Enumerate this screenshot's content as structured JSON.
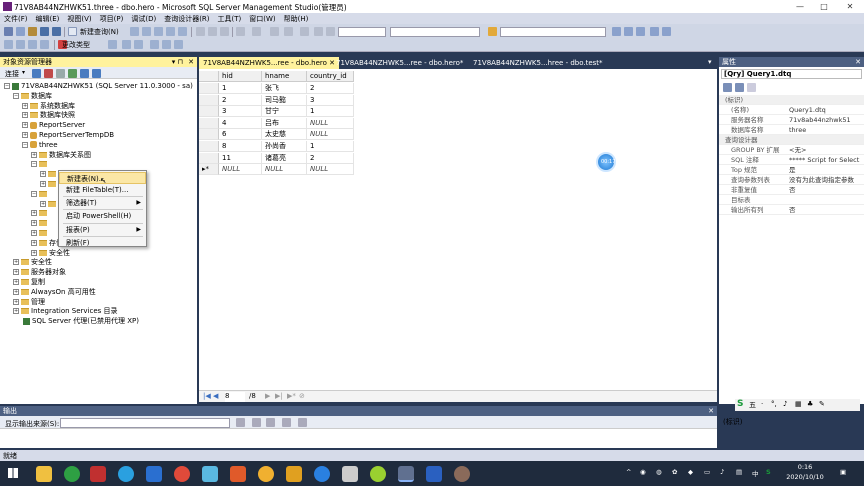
{
  "titlebar": {
    "title": "71V8AB44NZHWK51.three - dbo.hero - Microsoft SQL Server Management Studio(管理员)"
  },
  "menu": [
    "文件(F)",
    "编辑(E)",
    "视图(V)",
    "项目(P)",
    "调试(D)",
    "查询设计器(R)",
    "工具(T)",
    "窗口(W)",
    "帮助(H)"
  ],
  "toolbar": {
    "new_query": "新建查询(N)",
    "change_type": "更改类型"
  },
  "object_explorer": {
    "title": "对象资源管理器",
    "connect": "连接",
    "tree": [
      {
        "label": "71V8AB44NZHWK51 (SQL Server 11.0.3000 - sa)",
        "level": 0,
        "exp": "−",
        "icon": "server"
      },
      {
        "label": "数据库",
        "level": 1,
        "exp": "−",
        "icon": "folder"
      },
      {
        "label": "系统数据库",
        "level": 2,
        "exp": "+",
        "icon": "folder"
      },
      {
        "label": "数据库快照",
        "level": 2,
        "exp": "+",
        "icon": "folder"
      },
      {
        "label": "ReportServer",
        "level": 2,
        "exp": "+",
        "icon": "db"
      },
      {
        "label": "ReportServerTempDB",
        "level": 2,
        "exp": "+",
        "icon": "db"
      },
      {
        "label": "three",
        "level": 2,
        "exp": "−",
        "icon": "db"
      },
      {
        "label": "数据库关系图",
        "level": 3,
        "exp": "+",
        "icon": "folder"
      },
      {
        "label": "",
        "level": 3,
        "exp": "−",
        "icon": "folder"
      },
      {
        "label": "",
        "level": 4,
        "exp": "+",
        "icon": "folder"
      },
      {
        "label": "",
        "level": 4,
        "exp": "+",
        "icon": "folder"
      },
      {
        "label": "",
        "level": 3,
        "exp": "−",
        "icon": "folder"
      },
      {
        "label": "",
        "level": 4,
        "exp": "+",
        "icon": "folder"
      },
      {
        "label": "",
        "level": 3,
        "exp": "+",
        "icon": "folder"
      },
      {
        "label": "",
        "level": 3,
        "exp": "+",
        "icon": "folder"
      },
      {
        "label": "",
        "level": 3,
        "exp": "+",
        "icon": "folder"
      },
      {
        "label": "存储",
        "level": 3,
        "exp": "+",
        "icon": "folder"
      },
      {
        "label": "安全性",
        "level": 3,
        "exp": "+",
        "icon": "folder"
      },
      {
        "label": "安全性",
        "level": 1,
        "exp": "+",
        "icon": "folder"
      },
      {
        "label": "服务器对象",
        "level": 1,
        "exp": "+",
        "icon": "folder"
      },
      {
        "label": "复制",
        "level": 1,
        "exp": "+",
        "icon": "folder"
      },
      {
        "label": "AlwaysOn 高可用性",
        "level": 1,
        "exp": "+",
        "icon": "folder"
      },
      {
        "label": "管理",
        "level": 1,
        "exp": "+",
        "icon": "folder"
      },
      {
        "label": "Integration Services 目录",
        "level": 1,
        "exp": "+",
        "icon": "folder"
      },
      {
        "label": "SQL Server 代理(已禁用代理 XP)",
        "level": 1,
        "exp": "",
        "icon": "server"
      }
    ]
  },
  "context_menu": {
    "items": [
      {
        "label": "新建表(N)...",
        "submenu": false,
        "highlighted": true
      },
      {
        "label": "新建 FileTable(T)...",
        "submenu": false,
        "highlighted": false
      },
      {
        "label": "筛选器(T)",
        "submenu": true,
        "highlighted": false
      },
      {
        "label": "启动 PowerShell(H)",
        "submenu": false,
        "highlighted": false
      },
      {
        "label": "报表(P)",
        "submenu": true,
        "highlighted": false
      },
      {
        "label": "刷新(F)",
        "submenu": false,
        "highlighted": false
      }
    ]
  },
  "tabs": [
    {
      "label": "71V8AB44NZHWK5...ree - dbo.hero",
      "active": true,
      "closable": true
    },
    {
      "label": "71V8AB44NZHWK5...ree - dbo.hero*",
      "active": false,
      "closable": false
    },
    {
      "label": "71V8AB44NZHWK5...hree - dbo.test*",
      "active": false,
      "closable": false
    }
  ],
  "grid": {
    "columns": [
      "hid",
      "hname",
      "country_id"
    ],
    "rows": [
      [
        "1",
        "张飞",
        "2"
      ],
      [
        "2",
        "司马懿",
        "3"
      ],
      [
        "3",
        "甘宁",
        "1"
      ],
      [
        "4",
        "吕布",
        "NULL"
      ],
      [
        "6",
        "太史慈",
        "NULL"
      ],
      [
        "8",
        "孙尚香",
        "1"
      ],
      [
        "11",
        "诸葛亮",
        "2"
      ],
      [
        "NULL",
        "NULL",
        "NULL"
      ]
    ]
  },
  "nav": {
    "current": "8",
    "total": "/8"
  },
  "properties": {
    "title": "属性",
    "object": "[Qry] Query1.dtq",
    "rows": [
      {
        "k": "(标识)",
        "v": "",
        "cat": true
      },
      {
        "k": "(名称)",
        "v": "Query1.dtq",
        "cat": false
      },
      {
        "k": "服务器名称",
        "v": "71v8ab44nzhwk51",
        "cat": false
      },
      {
        "k": "数据库名称",
        "v": "three",
        "cat": false
      },
      {
        "k": "查询设计器",
        "v": "",
        "cat": true
      },
      {
        "k": "GROUP BY 扩展",
        "v": "<无>",
        "cat": false
      },
      {
        "k": "SQL 注释",
        "v": "***** Script for Select",
        "cat": false
      },
      {
        "k": "Top 规范",
        "v": "是",
        "cat": false
      },
      {
        "k": "查询参数列表",
        "v": "没有为此查询指定参数",
        "cat": false
      },
      {
        "k": "非重复值",
        "v": "否",
        "cat": false
      },
      {
        "k": "目标表",
        "v": "",
        "cat": false
      },
      {
        "k": "输出所有列",
        "v": "否",
        "cat": false
      }
    ],
    "footer": "(标识)"
  },
  "output": {
    "title": "输出",
    "source_label": "显示输出来源(S):"
  },
  "status": {
    "text": "就绪"
  },
  "taskbar": {
    "time": "0:16",
    "date": "2020/10/10"
  },
  "cursor_badge": "00:17"
}
